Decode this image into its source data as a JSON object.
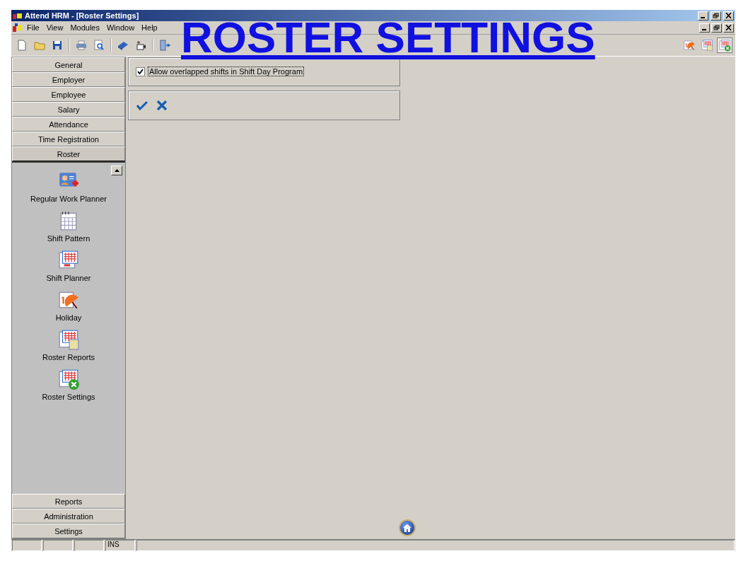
{
  "window": {
    "title": "Attend HRM - [Roster Settings]"
  },
  "menu": [
    "File",
    "View",
    "Modules",
    "Window",
    "Help"
  ],
  "heading": "ROSTER SETTINGS",
  "sidebar": [
    {
      "label": "General",
      "expanded": false
    },
    {
      "label": "Employer",
      "expanded": false
    },
    {
      "label": "Employee",
      "expanded": false
    },
    {
      "label": "Salary",
      "expanded": false
    },
    {
      "label": "Attendance",
      "expanded": false
    },
    {
      "label": "Time Registration",
      "expanded": false
    },
    {
      "label": "Roster",
      "expanded": true,
      "items": [
        "Regular Work Planner",
        "Shift Pattern",
        "Shift Planner",
        "Holiday",
        "Roster Reports",
        "Roster Settings"
      ]
    },
    {
      "label": "Reports",
      "expanded": false
    },
    {
      "label": "Administration",
      "expanded": false
    },
    {
      "label": "Settings",
      "expanded": false
    }
  ],
  "option": {
    "label": "Allow overlapped shifts in Shift Day Program",
    "checked": true
  },
  "status_bar": {
    "mode": "INS"
  }
}
